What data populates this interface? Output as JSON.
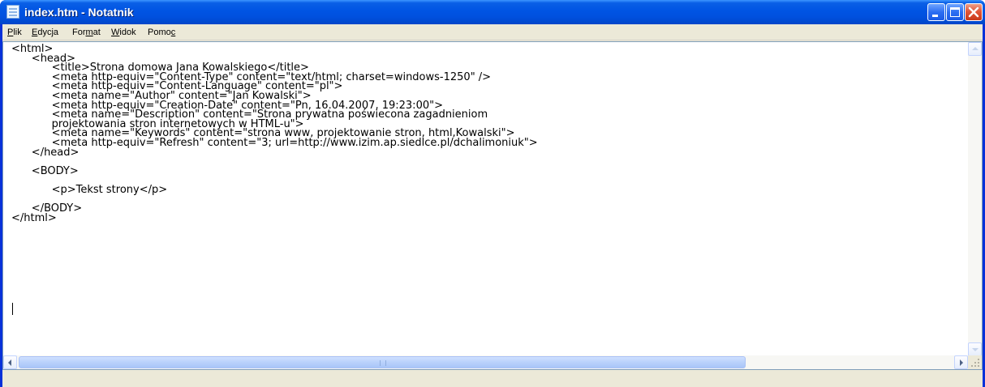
{
  "window": {
    "title": "index.htm - Notatnik",
    "icon": "notepad-icon"
  },
  "menu": {
    "items": [
      {
        "label": "Plik",
        "mnemonic_index": 0
      },
      {
        "label": "Edycja",
        "mnemonic_index": 0
      },
      {
        "label": "Format",
        "mnemonic_index": 3
      },
      {
        "label": "Widok",
        "mnemonic_index": 0
      },
      {
        "label": "Pomoc",
        "mnemonic_index": 4
      }
    ]
  },
  "editor": {
    "lines": [
      "<html>",
      "\t<head>",
      "\t\t<title>Strona domowa Jana Kowalskiego</title>",
      "\t\t<meta http-equiv=\"Content-Type\" content=\"text/html; charset=windows-1250\" />",
      "\t\t<meta http-equiv=\"Content-Language\" content=\"pl\">",
      "\t\t<meta name=\"Author\" content=\"Jan Kowalski\">",
      "\t\t<meta http-equiv=\"Creation-Date\" content=\"Pn, 16.04.2007, 19:23:00\">",
      "\t\t<meta name=\"Description\" content=\"Strona prywatna poświecona zagadnieniom",
      "\t\tprojektowania stron internetowych w HTML-u\">",
      "\t\t<meta name=\"Keywords\" content=\"strona www, projektowanie stron, html,Kowalski\">",
      "\t\t<meta http-equiv=\"Refresh\" content=\"3; url=http://www.izim.ap.siedlce.pl/dchalimoniuk\">",
      "\t</head>",
      "",
      "\t<BODY>",
      "",
      "\t\t<p>Tekst strony</p>",
      "",
      "\t</BODY>",
      "</html>"
    ]
  },
  "colors": {
    "titlebar": "#0054e3",
    "close_button": "#e2573a",
    "menubar": "#ece9d8",
    "editor_background": "#ffffff"
  }
}
